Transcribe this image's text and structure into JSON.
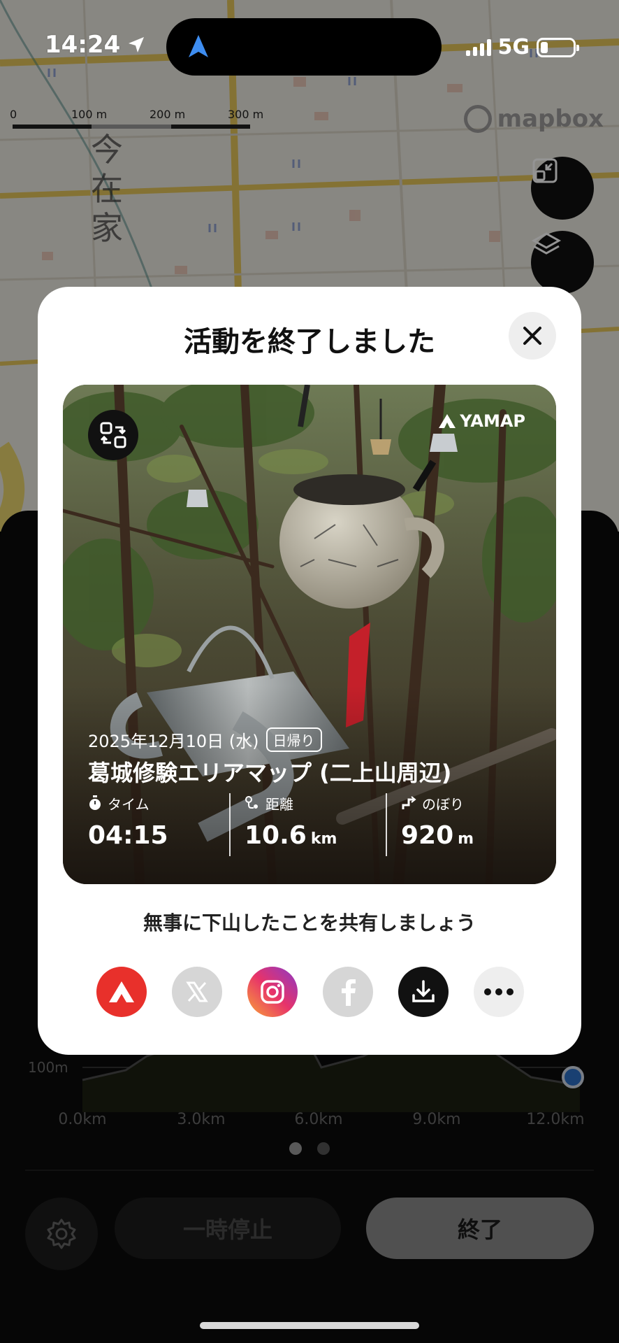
{
  "status_bar": {
    "time": "14:24",
    "network": "5G"
  },
  "map": {
    "scale_labels": [
      "0",
      "100 m",
      "200 m",
      "300 m"
    ],
    "place_label": "今在家",
    "attribution": "mapbox"
  },
  "modal": {
    "title": "活動を終了しました",
    "card": {
      "brand": "YAMAP",
      "date": "2025年12月10日 (水)",
      "trip_type": "日帰り",
      "map_name": "葛城修験エリアマップ (二上山周辺)",
      "stats": [
        {
          "label": "タイム",
          "value": "04:15",
          "unit": ""
        },
        {
          "label": "距離",
          "value": "10.6",
          "unit": "km"
        },
        {
          "label": "のぼり",
          "value": "920",
          "unit": "m"
        }
      ]
    },
    "share_prompt": "無事に下山したことを共有しましょう",
    "share_targets": [
      "yamap",
      "x",
      "instagram",
      "facebook",
      "download",
      "more"
    ]
  },
  "elevation_chart": {
    "y_labels": [
      "100m"
    ],
    "x_labels": [
      "0.0km",
      "3.0km",
      "6.0km",
      "9.0km",
      "12.0km"
    ]
  },
  "controls": {
    "pause_label": "一時停止",
    "end_label": "終了"
  },
  "colors": {
    "accent_red": "#e8302b",
    "brand_dark": "#111111"
  }
}
